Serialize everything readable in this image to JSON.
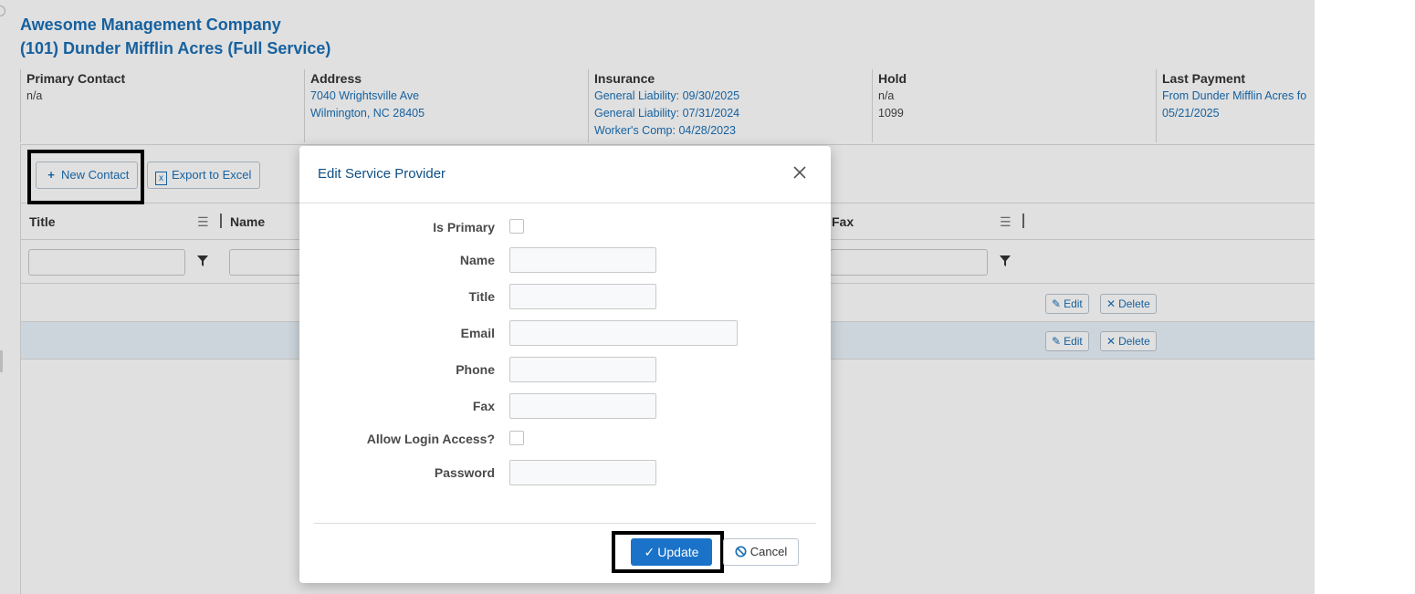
{
  "header": {
    "company": "Awesome Management Company",
    "property": "(101) Dunder Mifflin Acres (Full Service)"
  },
  "info": {
    "primary_contact": {
      "label": "Primary Contact",
      "value": "n/a"
    },
    "address": {
      "label": "Address",
      "line1": "7040 Wrightsville Ave",
      "line2": "Wilmington, NC 28405"
    },
    "insurance": {
      "label": "Insurance",
      "line1": "General Liability: 09/30/2025",
      "line2": "General Liability: 07/31/2024",
      "line3": "Worker's Comp: 04/28/2023"
    },
    "hold": {
      "label": "Hold",
      "line1": "n/a",
      "line2": "1099"
    },
    "last_payment": {
      "label": "Last Payment",
      "line1": "From Dunder Mifflin Acres fo",
      "line2": "05/21/2025"
    }
  },
  "toolbar": {
    "new_contact": "New Contact",
    "export_excel": "Export to Excel"
  },
  "columns": {
    "title": "Title",
    "name": "Name",
    "fax": "Fax"
  },
  "rows": [
    {
      "edit": "Edit",
      "delete": "Delete"
    },
    {
      "edit": "Edit",
      "delete": "Delete"
    }
  ],
  "modal": {
    "title": "Edit Service Provider",
    "fields": {
      "is_primary": "Is Primary",
      "name": "Name",
      "title": "Title",
      "email": "Email",
      "phone": "Phone",
      "fax": "Fax",
      "allow_login": "Allow Login Access?",
      "password": "Password"
    },
    "update": "Update",
    "cancel": "Cancel"
  },
  "colors": {
    "accent": "#1a6fb5",
    "primary_button": "#1a73c9"
  }
}
